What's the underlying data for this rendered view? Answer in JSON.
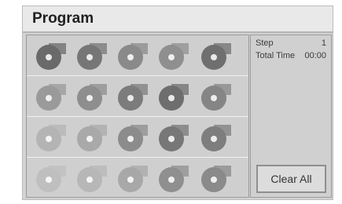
{
  "window": {
    "title": "Program"
  },
  "info": {
    "step_label": "Step",
    "step_value": "1",
    "total_time_label": "Total Time",
    "total_time_value": "00:00"
  },
  "clear_all_label": "Clear All",
  "track_icon": "cd-disc-icon",
  "tracks": [
    [
      "#6a6a6a",
      "#767676",
      "#8a8a8a",
      "#8f8f8f",
      "#6f6f6f"
    ],
    [
      "#9a9a9a",
      "#8e8e8e",
      "#7c7c7c",
      "#6e6e6e",
      "#858585"
    ],
    [
      "#b4b4b4",
      "#a9a9a9",
      "#8c8c8c",
      "#777777",
      "#7e7e7e"
    ],
    [
      "#bfbfbf",
      "#b7b7b7",
      "#a8a8a8",
      "#8f8f8f",
      "#8a8a8a"
    ]
  ]
}
